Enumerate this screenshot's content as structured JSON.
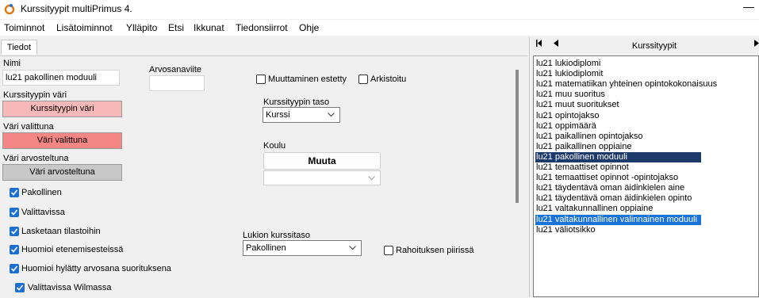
{
  "window": {
    "title": "Kurssityypit multiPrimus 4.",
    "minimize_glyph": "—"
  },
  "menu": [
    "Toiminnot",
    "Lisätoiminnot",
    "Ylläpito",
    "Etsi",
    "Ikkunat",
    "Tiedonsiirrot",
    "Ohje"
  ],
  "tab": "Tiedot",
  "form": {
    "name_label": "Nimi",
    "name_value": "lu21 pakollinen moduuli",
    "color_label": "Kurssityypin väri",
    "color_button": "Kurssityypin väri",
    "selected_color_label": "Väri valittuna",
    "selected_color_button": "Väri valittuna",
    "graded_color_label": "Väri arvosteltuna",
    "graded_color_button": "Väri arvosteltuna",
    "grade_suffix_label": "Arvosanaviite",
    "grade_suffix_value": "",
    "checkboxes": {
      "pakollinen": "Pakollinen",
      "valittavissa": "Valittavissa",
      "lasketaan": "Lasketaan tilastoihin",
      "huomioi_eten": "Huomioi etenemisesteissä",
      "huomioi_hylatty": "Huomioi hylätty arvosana suorituksena",
      "wilma": "Valittavissa Wilmassa",
      "muuttaminen": "Muuttaminen estetty",
      "arkistoitu": "Arkistoitu",
      "rahoitus": "Rahoituksen piirissä"
    },
    "level_label": "Kurssityypin taso",
    "level_value": "Kurssi",
    "school_label": "Koulu",
    "change_button": "Muuta",
    "school_value": "",
    "lukio_label": "Lukion kurssitaso",
    "lukio_value": "Pakollinen"
  },
  "colors": {
    "course_color": "#f6b8b8",
    "selected_color": "#f48686",
    "graded_color": "#c8c8c8",
    "checkbox_blue": "#1f6fd1",
    "selection_dark": "#1d3a6b",
    "selection_blue": "#1a73d9"
  },
  "list_panel": {
    "title": "Kurssityypit",
    "first_icon": "first-page-icon",
    "prev_icon": "prev-icon",
    "next_icon": "next-icon",
    "items": [
      "lu21 lukiodiplomi",
      "lu21 lukiodiplomit",
      "lu21 matematiikan yhteinen opintokokonaisuus",
      "lu21 muu suoritus",
      "lu21 muut suoritukset",
      "lu21 opintojakso",
      "lu21 oppimäärä",
      "lu21 paikallinen opintojakso",
      "lu21 paikallinen oppiaine",
      "lu21 pakollinen moduuli",
      "lu21 temaattiset opinnot",
      "lu21 temaattiset opinnot -opintojakso",
      "lu21 täydentävä oman äidinkielen aine",
      "lu21 täydentävä oman äidinkielen opinto",
      "lu21 valtakunnallinen oppiaine",
      "lu21 valtakunnallinen valinnainen moduuli",
      "lu21 väliotsikko"
    ],
    "selected_index": 9,
    "highlighted_index": 15
  }
}
